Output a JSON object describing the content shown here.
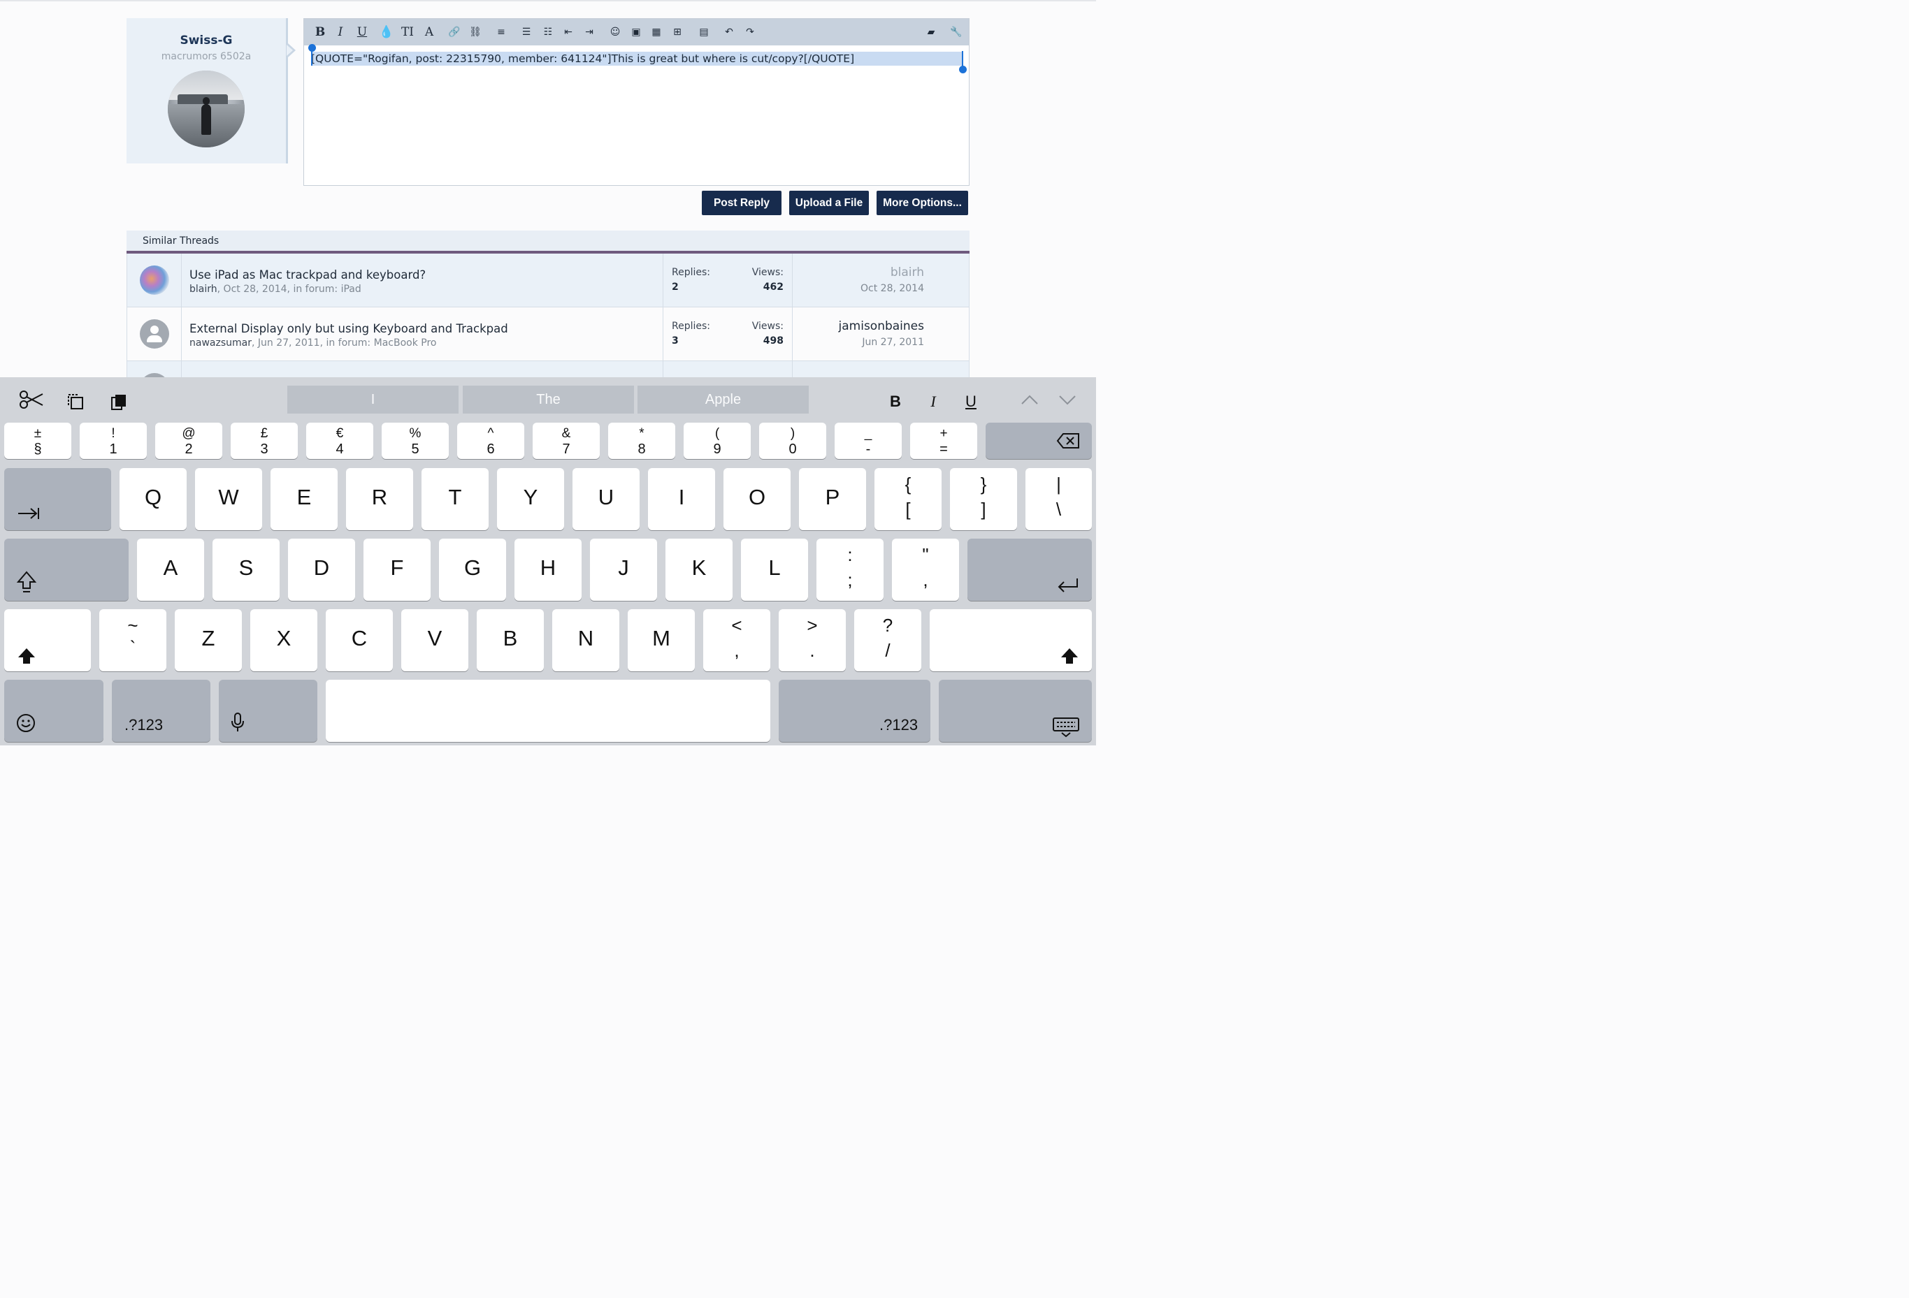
{
  "user": {
    "name": "Swiss-G",
    "title": "macrumors 6502a"
  },
  "editor": {
    "toolbar_icons": [
      "bold-icon",
      "italic-icon",
      "underline-icon",
      "text-color-icon",
      "font-size-icon",
      "font-icon",
      "link-icon",
      "unlink-icon",
      "align-icon",
      "bullet-list-icon",
      "numbered-list-icon",
      "outdent-icon",
      "indent-icon",
      "smiley-icon",
      "image-icon",
      "media-icon",
      "insert-icon",
      "save-draft-icon",
      "undo-icon",
      "redo-icon",
      "remove-format-icon",
      "wrench-icon"
    ],
    "toolbar_glyphs": [
      "B",
      "I",
      "U",
      "💧",
      "TI",
      "A",
      "🔗",
      "⛓",
      "≡",
      "☰",
      "☷",
      "⇤",
      "⇥",
      "☺",
      "▣",
      "▦",
      "⊞",
      "▤",
      "↶",
      "↷",
      "▰",
      "🔧"
    ],
    "content": "[QUOTE=\"Rogifan, post: 22315790, member: 641124\"]This is great but where is cut/copy?[/QUOTE]"
  },
  "buttons": {
    "post_reply": "Post Reply",
    "upload": "Upload a File",
    "more": "More Options..."
  },
  "similar": {
    "heading": "Similar Threads",
    "threads": [
      {
        "title": "Use iPad as Mac trackpad and keyboard?",
        "author": "blairh",
        "date": "Oct 28, 2014",
        "forum_prefix": ", in forum: ",
        "forum": "iPad",
        "replies_label": "Replies:",
        "replies": "2",
        "views_label": "Views:",
        "views": "462",
        "last_user": "blairh",
        "last_date": "Oct 28, 2014"
      },
      {
        "title": "External Display only but using Keyboard and Trackpad",
        "author": "nawazsumar",
        "date": "Jun 27, 2011",
        "forum_prefix": ", in forum: ",
        "forum": "MacBook Pro",
        "replies_label": "Replies:",
        "replies": "3",
        "views_label": "Views:",
        "views": "498",
        "last_user": "jamisonbaines",
        "last_date": "Jun 27, 2011"
      }
    ]
  },
  "keyboard": {
    "suggestions": [
      "I",
      "The",
      "Apple"
    ],
    "format": {
      "bold": "B",
      "italic": "I",
      "underline": "U"
    },
    "number_row": [
      {
        "top": "±",
        "bottom": "§"
      },
      {
        "top": "!",
        "bottom": "1"
      },
      {
        "top": "@",
        "bottom": "2"
      },
      {
        "top": "£",
        "bottom": "3"
      },
      {
        "top": "€",
        "bottom": "4"
      },
      {
        "top": "%",
        "bottom": "5"
      },
      {
        "top": "^",
        "bottom": "6"
      },
      {
        "top": "&",
        "bottom": "7"
      },
      {
        "top": "*",
        "bottom": "8"
      },
      {
        "top": "(",
        "bottom": "9"
      },
      {
        "top": ")",
        "bottom": "0"
      },
      {
        "top": "_",
        "bottom": "-"
      },
      {
        "top": "+",
        "bottom": "="
      }
    ],
    "row_q": [
      "Q",
      "W",
      "E",
      "R",
      "T",
      "Y",
      "U",
      "I",
      "O",
      "P"
    ],
    "row_q_sym": [
      {
        "top": "{",
        "bottom": "["
      },
      {
        "top": "}",
        "bottom": "]"
      },
      {
        "top": "|",
        "bottom": "\\"
      }
    ],
    "row_a": [
      "A",
      "S",
      "D",
      "F",
      "G",
      "H",
      "J",
      "K",
      "L"
    ],
    "row_a_sym": [
      {
        "top": ":",
        "bottom": ";"
      },
      {
        "top": "\"",
        "bottom": ","
      }
    ],
    "row_z_pre": {
      "top": "~",
      "bottom": "`"
    },
    "row_z": [
      "Z",
      "X",
      "C",
      "V",
      "B",
      "N",
      "M"
    ],
    "row_z_sym": [
      {
        "top": "<",
        "bottom": ","
      },
      {
        "top": ">",
        "bottom": "."
      },
      {
        "top": "?",
        "bottom": "/"
      }
    ],
    "mode_label": ".?123"
  },
  "colors": {
    "accent": "#172b4d",
    "selection": "#c9dbf2",
    "handle": "#1c72d8"
  }
}
